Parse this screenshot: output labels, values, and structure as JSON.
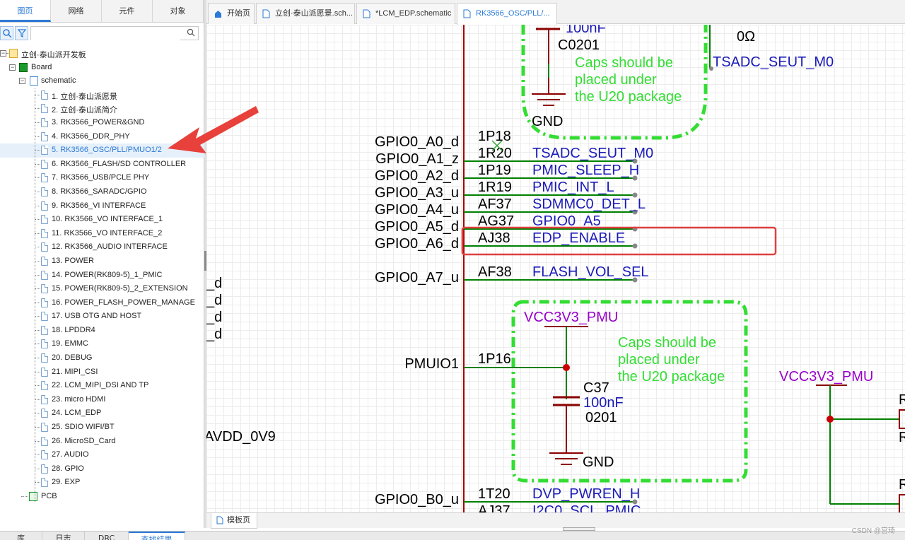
{
  "left_tabs": [
    "图页",
    "网络",
    "元件",
    "对象"
  ],
  "search": {
    "value": "",
    "placeholder": ""
  },
  "tree": {
    "project": "立创·泰山派开发板",
    "board": "Board",
    "schematic": "schematic",
    "pages": [
      "1. 立创·泰山派愿景",
      "2. 立创·泰山派简介",
      "3. RK3566_POWER&GND",
      "4. RK3566_DDR_PHY",
      "5. RK3566_OSC/PLL/PMUO1/2",
      "6. RK3566_FLASH/SD CONTROLLER",
      "7. RK3566_USB/PCLE PHY",
      "8. RK3566_SARADC/GPIO",
      "9. RK3566_VI INTERFACE",
      "10. RK3566_VO INTERFACE_1",
      "11. RK3566_VO INTERFACE_2",
      "12. RK3566_AUDIO INTERFACE",
      "13. POWER",
      "14. POWER(RK809-5)_1_PMIC",
      "15. POWER(RK809-5)_2_EXTENSION",
      "16. POWER_FLASH_POWER_MANAGE",
      "17. USB OTG AND HOST",
      "18. LPDDR4",
      "19. EMMC",
      "20. DEBUG",
      "21. MIPI_CSI",
      "22. LCM_MIPI_DSI AND TP",
      "23. micro HDMI",
      "24. LCM_EDP",
      "25. SDIO WIFI/BT",
      "26. MicroSD_Card",
      "27. AUDIO",
      "28. GPIO",
      "29. EXP"
    ],
    "selected_index": 4,
    "pcb": "PCB"
  },
  "doc_tabs": [
    {
      "label": "开始页",
      "icon": "home-icon"
    },
    {
      "label": "立创·泰山派愿景.sch...",
      "icon": "document-icon"
    },
    {
      "label": "*LCM_EDP.schematic",
      "icon": "document-icon"
    },
    {
      "label": "RK3566_OSC/PLL/...",
      "icon": "document-icon"
    }
  ],
  "sheet_tab": "模板页",
  "bottom_tabs": [
    "库",
    "日志",
    "DRC",
    "查找结果"
  ],
  "watermark": "CSDN @宫琦",
  "schematic": {
    "left_labels": [
      "GPIO0_A0_d",
      "GPIO0_A1_z",
      "GPIO0_A2_d",
      "GPIO0_A3_u",
      "GPIO0_A4_u",
      "GPIO0_A5_d",
      "GPIO0_A6_d",
      "GPIO0_A7_u",
      "PMUIO1",
      "GPIO0_B0_u"
    ],
    "pins": [
      "1P18",
      "1R20",
      "1P19",
      "1R19",
      "AF37",
      "AG37",
      "AJ38",
      "AF38",
      "1P16",
      "1T20",
      "AJ37"
    ],
    "nets": [
      "TSADC_SEUT_M0",
      "PMIC_SLEEP_H",
      "PMIC_INT_L",
      "SDMMC0_DET_L",
      "GPIO0_A5",
      "EDP_ENABLE",
      "FLASH_VOL_SEL",
      "DVP_PWREN_H",
      "I2C0_SCL_PMIC"
    ],
    "partial_left": [
      "_d",
      "_d",
      "_d",
      "_d",
      "AVDD_0V9"
    ],
    "top_cap": {
      "value": "100nF",
      "package": "C0201",
      "gnd": "GND"
    },
    "top_resistor": "0Ω",
    "top_net": "TSADC_SEUT_M0",
    "note": [
      "Caps should be",
      "placed under",
      "the U20 package"
    ],
    "power_net": "VCC3V3_PMU",
    "cap2": {
      "ref": "C37",
      "value": "100nF",
      "package": "0201",
      "gnd": "GND"
    },
    "power_net_right": "VCC3V3_PMU",
    "right_edge": [
      "R",
      "R",
      "R"
    ]
  },
  "colors": {
    "accent": "#2a7ad6",
    "wire": "#008000",
    "net_label": "#1a1ab8",
    "bus": "#a50000",
    "note": "#33dd33",
    "power": "#9900cc",
    "highlight": "#e04040"
  }
}
